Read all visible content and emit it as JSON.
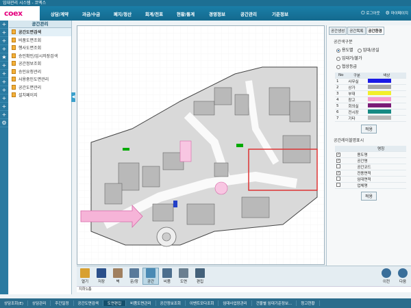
{
  "window_title": "임대관리 시스템 - 코엑스",
  "logo": "coex",
  "menu": [
    "상담/계약",
    "과금/수금",
    "폐지/정산",
    "회계/전표",
    "현황/통계",
    "경영정보",
    "공간관리",
    "기준정보"
  ],
  "header_right": {
    "logout": "로그아웃",
    "mypage": "마이페이지"
  },
  "sidepanel": {
    "title": "공간관리",
    "items": [
      "공간도면검색",
      "비품도면조회",
      "행사도면조회",
      "승인확인/임시저장검색",
      "공간정보조회",
      "승인요청관리",
      "사용중인도면관리",
      "공간도면관리",
      "설치페이지"
    ]
  },
  "right_panel": {
    "tabs": [
      "공간생성",
      "공간목록",
      "공간환경"
    ],
    "color_section": "공간색구분",
    "radios": [
      "용도별",
      "임대/공실",
      "임대가/불가",
      "임대협정",
      "평균/공실"
    ],
    "radio_row1": [
      "용도별",
      "임대/공실"
    ],
    "radio_row2": [
      "임대가/불가"
    ],
    "radio_row3": [
      "협상등급"
    ],
    "color_table": {
      "headers": [
        "No",
        "구분",
        "색상"
      ],
      "rows": [
        {
          "no": "1",
          "name": "사무실",
          "color": "#1a1ae6"
        },
        {
          "no": "2",
          "name": "상가",
          "color": "#a8a8a8"
        },
        {
          "no": "3",
          "name": "부대",
          "color": "#f2ef2c"
        },
        {
          "no": "4",
          "name": "창고",
          "color": "#f59acd"
        },
        {
          "no": "5",
          "name": "회의실",
          "color": "#7a1b77"
        },
        {
          "no": "6",
          "name": "전시장",
          "color": "#168a84"
        },
        {
          "no": "7",
          "name": "기타",
          "color": "#b8b8b8"
        }
      ]
    },
    "apply1": "적용",
    "layer_section": "공간레이블명표시",
    "layer_table": {
      "header": "명칭",
      "rows": [
        {
          "name": "용도명",
          "checked": true
        },
        {
          "name": "공간명",
          "checked": true
        },
        {
          "name": "공간코드",
          "checked": false
        },
        {
          "name": "전용면적",
          "checked": true
        },
        {
          "name": "임대면적",
          "checked": false
        },
        {
          "name": "업체명",
          "checked": false
        }
      ]
    },
    "apply2": "적용"
  },
  "toolbar": {
    "tools": [
      "열기",
      "저장",
      "벽",
      "문/창",
      "공간",
      "비품",
      "도면",
      "편집"
    ],
    "right_tools": [
      "이전",
      "다음"
    ]
  },
  "floor_label": "지하1층",
  "bottom_tabs": [
    "상담조회(E)",
    "상담관리",
    "주간일정",
    "공간도면검색",
    "도면편집",
    "비품도면관리",
    "공간정보조회",
    "이벤트모다조회",
    "임대사업장관리",
    "건물별 임대기준정보...",
    "청고현황"
  ],
  "colors": {
    "header": "#1a7fa8",
    "accent": "#e5007e"
  }
}
